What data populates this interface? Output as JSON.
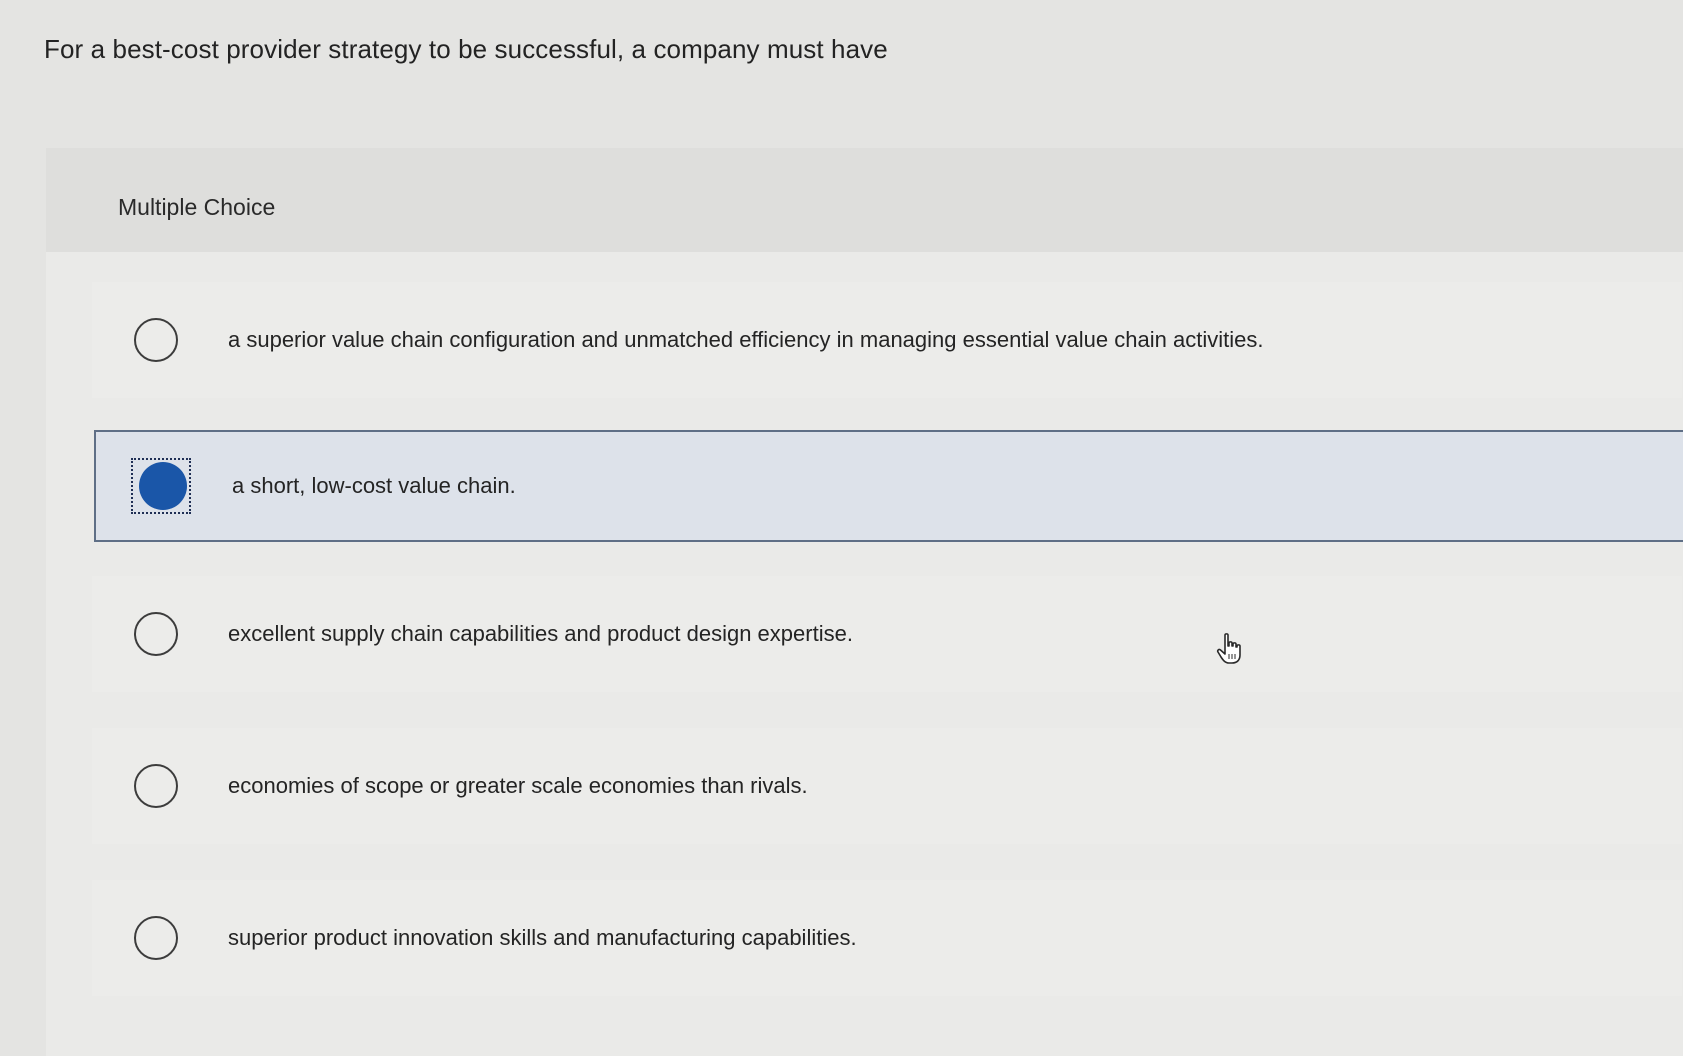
{
  "question": {
    "text": "For a best-cost provider strategy to be successful, a company must have"
  },
  "multiple_choice": {
    "title": "Multiple Choice",
    "options": [
      {
        "label": "a superior value chain configuration and unmatched efficiency in managing essential value chain activities.",
        "selected": false
      },
      {
        "label": "a short, low-cost value chain.",
        "selected": true
      },
      {
        "label": "excellent supply chain capabilities and product design expertise.",
        "selected": false
      },
      {
        "label": "economies of scope or greater scale economies than rivals.",
        "selected": false
      },
      {
        "label": "superior product innovation skills and manufacturing capabilities.",
        "selected": false
      }
    ]
  },
  "colors": {
    "background": "#e4e4e2",
    "selected_fill": "#1a56a8",
    "selected_row": "#dde2ea"
  },
  "icons": {
    "cursor": "hand-pointer-icon"
  }
}
